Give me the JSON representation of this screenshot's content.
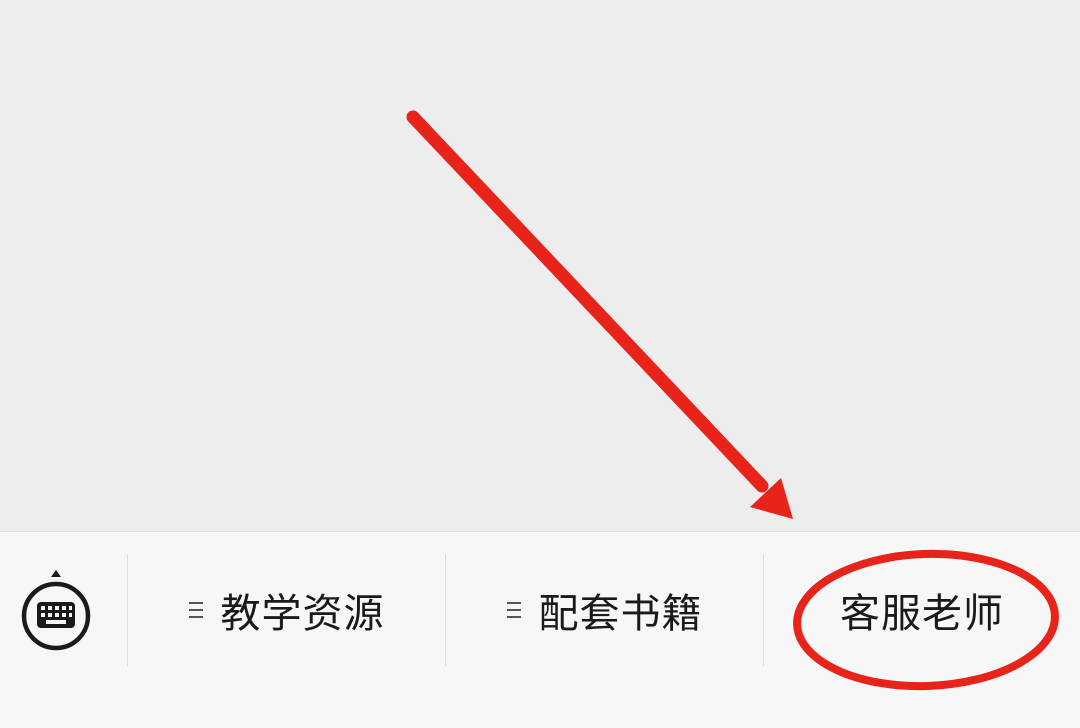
{
  "menu_bar": {
    "keyboard_icon": "keyboard-icon",
    "items": [
      {
        "label": "教学资源",
        "has_submenu": true,
        "icon": "list-icon"
      },
      {
        "label": "配套书籍",
        "has_submenu": true,
        "icon": "list-icon"
      },
      {
        "label": "客服老师",
        "has_submenu": false
      }
    ]
  },
  "colors": {
    "chat_background": "#ededed",
    "menu_background": "#f7f7f7",
    "annotation_red": "#e8231a",
    "text": "#1a1a1a"
  }
}
